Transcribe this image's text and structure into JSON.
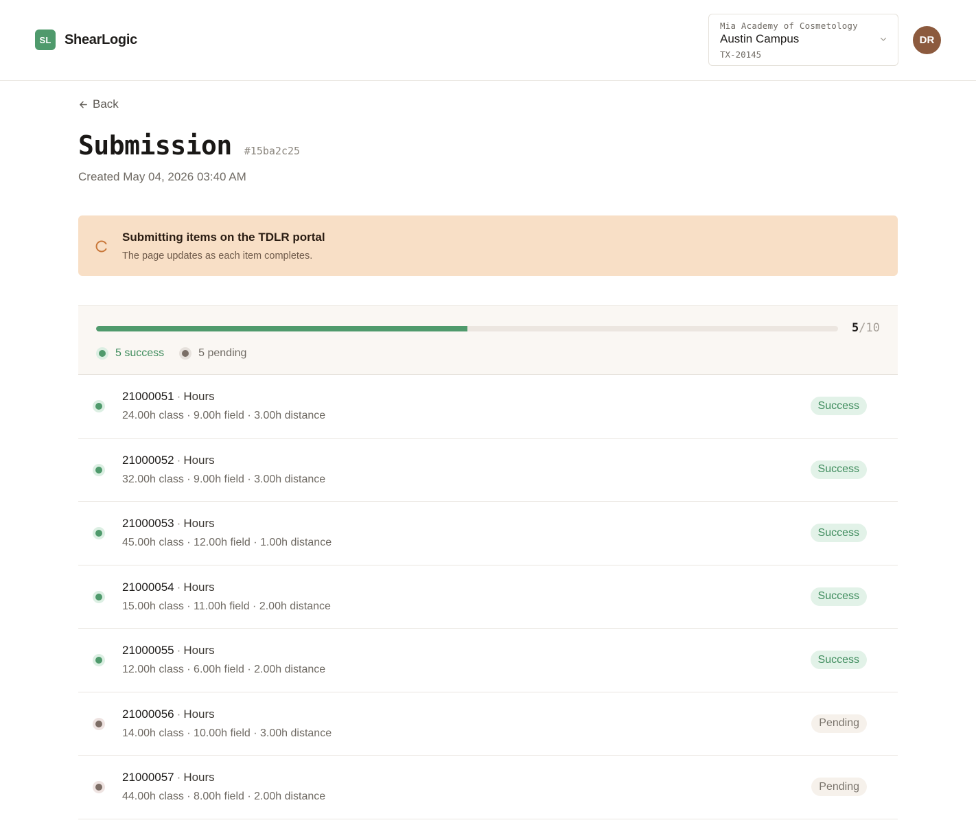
{
  "brand": {
    "logo_text": "SL",
    "name": "ShearLogic",
    "color": "#4f9a6c"
  },
  "campus": {
    "org": "Mia Academy of Cosmetology",
    "name": "Austin Campus",
    "code": "TX-20145"
  },
  "user": {
    "initials": "DR",
    "avatar_color": "#8c5a3e"
  },
  "nav": {
    "back_label": "Back"
  },
  "page": {
    "title": "Submission",
    "id": "#15ba2c25",
    "created": "Created May 04, 2026 03:40 AM"
  },
  "banner": {
    "title": "Submitting items on the TDLR portal",
    "subtitle": "The page updates as each item completes.",
    "background": "#f8dfc6"
  },
  "progress": {
    "done": "5",
    "separator": "/",
    "total": "10",
    "fraction": 0.5,
    "success_label": "5 success",
    "pending_label": "5 pending"
  },
  "items": [
    {
      "id": "21000051",
      "kind": "Hours",
      "detail": "24.00h class · 9.00h field · 3.00h distance",
      "status": "Success",
      "state": "success"
    },
    {
      "id": "21000052",
      "kind": "Hours",
      "detail": "32.00h class · 9.00h field · 3.00h distance",
      "status": "Success",
      "state": "success"
    },
    {
      "id": "21000053",
      "kind": "Hours",
      "detail": "45.00h class · 12.00h field · 1.00h distance",
      "status": "Success",
      "state": "success"
    },
    {
      "id": "21000054",
      "kind": "Hours",
      "detail": "15.00h class · 11.00h field · 2.00h distance",
      "status": "Success",
      "state": "success"
    },
    {
      "id": "21000055",
      "kind": "Hours",
      "detail": "12.00h class · 6.00h field · 2.00h distance",
      "status": "Success",
      "state": "success"
    },
    {
      "id": "21000056",
      "kind": "Hours",
      "detail": "14.00h class · 10.00h field · 3.00h distance",
      "status": "Pending",
      "state": "pending"
    },
    {
      "id": "21000057",
      "kind": "Hours",
      "detail": "44.00h class · 8.00h field · 2.00h distance",
      "status": "Pending",
      "state": "pending"
    }
  ],
  "colors": {
    "success": "#4f9a6c",
    "pending": "#7a6e66"
  },
  "icons": {
    "back": "arrow-left-icon",
    "select": "chevron-down-icon",
    "spinner": "spinner-icon"
  }
}
